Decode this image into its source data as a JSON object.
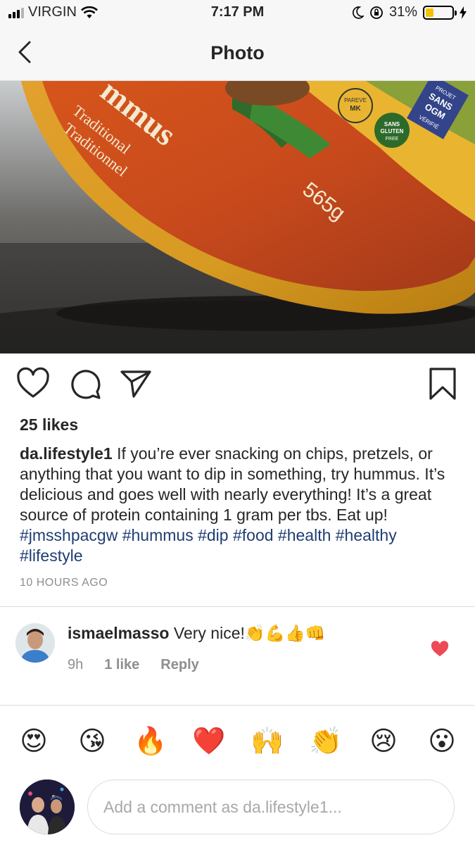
{
  "status_bar": {
    "carrier": "VIRGIN",
    "time": "7:17 PM",
    "battery": "31%",
    "battery_level": 0.31,
    "battery_color": "#f2c300"
  },
  "nav": {
    "title": "Photo",
    "back_icon": "chevron-left-icon"
  },
  "photo": {
    "label_product": "mmus",
    "label_line1": "Traditional",
    "label_line2": "Traditionnel",
    "label_weight": "565g",
    "badge_projet": "PROJET",
    "badge_sans": "SANS",
    "badge_ogm": "OGM",
    "badge_verifie": "VÉRIFIÉ",
    "badge_gluten_1": "SANS",
    "badge_gluten_2": "GLUTEN",
    "badge_gluten_3": "FREE",
    "badge_kosher_1": "PAREVE",
    "badge_kosher_2": "MK"
  },
  "actions": {
    "like_icon": "heart-outline-icon",
    "comment_icon": "comment-bubble-icon",
    "share_icon": "paper-plane-icon",
    "save_icon": "bookmark-icon"
  },
  "post": {
    "likes": "25 likes",
    "username": "da.lifestyle1",
    "caption": "If you’re ever snacking on chips, pretzels, or anything that you want to dip in something, try hummus. It’s delicious and goes well with nearly everything! It’s a great source of protein containing 1 gram per tbs. Eat up!",
    "hashtags": "#jmsshpacgw #hummus #dip #food #health #healthy #lifestyle",
    "timestamp": "10 HOURS AGO"
  },
  "comment": {
    "username": "ismaelmasso",
    "text": "Very nice!👏💪👍👊",
    "age": "9h",
    "likes": "1 like",
    "reply": "Reply",
    "heart_color": "#ed4956"
  },
  "emoji_bar": [
    "😍",
    "😘",
    "🔥",
    "❤️",
    "🙌",
    "👏",
    "😢",
    "😮"
  ],
  "input": {
    "placeholder": "Add a comment as da.lifestyle1..."
  }
}
